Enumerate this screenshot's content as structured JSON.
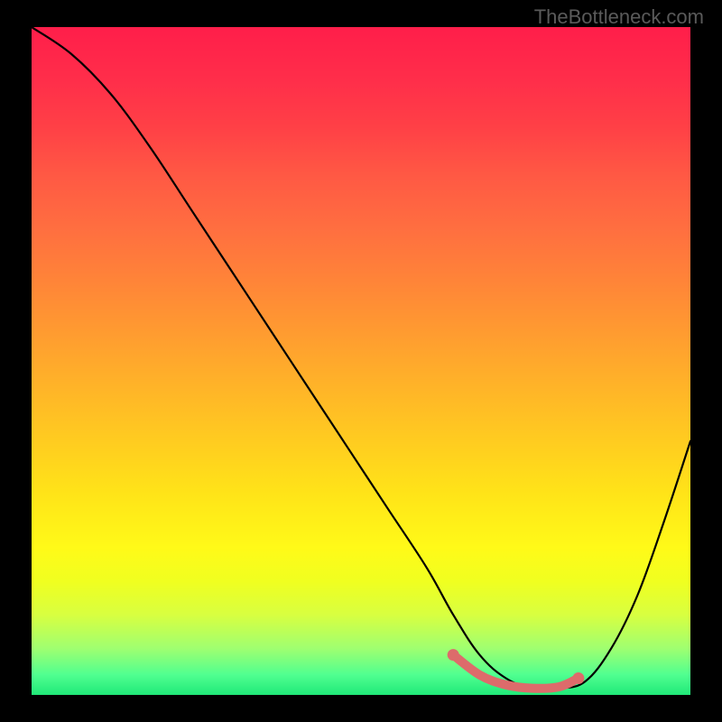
{
  "watermark": "TheBottleneck.com",
  "chart_data": {
    "type": "line",
    "title": "",
    "xlabel": "",
    "ylabel": "",
    "xlim": [
      0,
      100
    ],
    "ylim": [
      0,
      100
    ],
    "grid": false,
    "series": [
      {
        "name": "curve",
        "color": "#000000",
        "x": [
          0,
          6,
          12,
          18,
          24,
          30,
          36,
          42,
          48,
          54,
          60,
          64,
          68,
          72,
          76,
          80,
          84,
          88,
          92,
          96,
          100
        ],
        "values": [
          100,
          96,
          90,
          82,
          73,
          64,
          55,
          46,
          37,
          28,
          19,
          12,
          6,
          2.5,
          1,
          1,
          2,
          7,
          15,
          26,
          38
        ]
      },
      {
        "name": "valley-highlight",
        "color": "#dd6b6b",
        "x": [
          64,
          68,
          72,
          76,
          80,
          83
        ],
        "values": [
          6,
          3,
          1.5,
          1,
          1.2,
          2.5
        ]
      }
    ],
    "gradient_stops": [
      {
        "pos": 0,
        "color": "#ff1e4a"
      },
      {
        "pos": 50,
        "color": "#ffb428"
      },
      {
        "pos": 80,
        "color": "#fffa18"
      },
      {
        "pos": 100,
        "color": "#20e878"
      }
    ]
  }
}
